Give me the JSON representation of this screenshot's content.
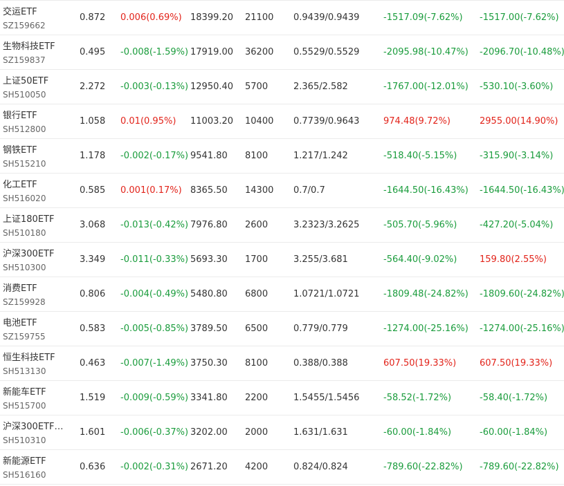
{
  "colors": {
    "up": "#e2231a",
    "down": "#1a9c3c",
    "text": "#333333",
    "subtext": "#666666",
    "divider": "#ebebeb"
  },
  "rows": [
    {
      "name": "交运ETF",
      "code": "SZ159662",
      "price": "0.872",
      "change": "0.006(0.69%)",
      "change_dir": "up",
      "market_value": "18399.20",
      "quantity": "21100",
      "cost": "0.9439/0.9439",
      "pl1": "-1517.09(-7.62%)",
      "pl1_dir": "down",
      "pl2": "-1517.00(-7.62%)",
      "pl2_dir": "down"
    },
    {
      "name": "生物科技ETF",
      "code": "SZ159837",
      "price": "0.495",
      "change": "-0.008(-1.59%)",
      "change_dir": "down",
      "market_value": "17919.00",
      "quantity": "36200",
      "cost": "0.5529/0.5529",
      "pl1": "-2095.98(-10.47%)",
      "pl1_dir": "down",
      "pl2": "-2096.70(-10.48%)",
      "pl2_dir": "down"
    },
    {
      "name": "上证50ETF",
      "code": "SH510050",
      "price": "2.272",
      "change": "-0.003(-0.13%)",
      "change_dir": "down",
      "market_value": "12950.40",
      "quantity": "5700",
      "cost": "2.365/2.582",
      "pl1": "-1767.00(-12.01%)",
      "pl1_dir": "down",
      "pl2": "-530.10(-3.60%)",
      "pl2_dir": "down"
    },
    {
      "name": "银行ETF",
      "code": "SH512800",
      "price": "1.058",
      "change": "0.01(0.95%)",
      "change_dir": "up",
      "market_value": "11003.20",
      "quantity": "10400",
      "cost": "0.7739/0.9643",
      "pl1": "974.48(9.72%)",
      "pl1_dir": "up",
      "pl2": "2955.00(14.90%)",
      "pl2_dir": "up"
    },
    {
      "name": "钢铁ETF",
      "code": "SH515210",
      "price": "1.178",
      "change": "-0.002(-0.17%)",
      "change_dir": "down",
      "market_value": "9541.80",
      "quantity": "8100",
      "cost": "1.217/1.242",
      "pl1": "-518.40(-5.15%)",
      "pl1_dir": "down",
      "pl2": "-315.90(-3.14%)",
      "pl2_dir": "down"
    },
    {
      "name": "化工ETF",
      "code": "SH516020",
      "price": "0.585",
      "change": "0.001(0.17%)",
      "change_dir": "up",
      "market_value": "8365.50",
      "quantity": "14300",
      "cost": "0.7/0.7",
      "pl1": "-1644.50(-16.43%)",
      "pl1_dir": "down",
      "pl2": "-1644.50(-16.43%)",
      "pl2_dir": "down"
    },
    {
      "name": "上证180ETF",
      "code": "SH510180",
      "price": "3.068",
      "change": "-0.013(-0.42%)",
      "change_dir": "down",
      "market_value": "7976.80",
      "quantity": "2600",
      "cost": "3.2323/3.2625",
      "pl1": "-505.70(-5.96%)",
      "pl1_dir": "down",
      "pl2": "-427.20(-5.04%)",
      "pl2_dir": "down"
    },
    {
      "name": "沪深300ETF",
      "code": "SH510300",
      "price": "3.349",
      "change": "-0.011(-0.33%)",
      "change_dir": "down",
      "market_value": "5693.30",
      "quantity": "1700",
      "cost": "3.255/3.681",
      "pl1": "-564.40(-9.02%)",
      "pl1_dir": "down",
      "pl2": "159.80(2.55%)",
      "pl2_dir": "up"
    },
    {
      "name": "消费ETF",
      "code": "SZ159928",
      "price": "0.806",
      "change": "-0.004(-0.49%)",
      "change_dir": "down",
      "market_value": "5480.80",
      "quantity": "6800",
      "cost": "1.0721/1.0721",
      "pl1": "-1809.48(-24.82%)",
      "pl1_dir": "down",
      "pl2": "-1809.60(-24.82%)",
      "pl2_dir": "down"
    },
    {
      "name": "电池ETF",
      "code": "SZ159755",
      "price": "0.583",
      "change": "-0.005(-0.85%)",
      "change_dir": "down",
      "market_value": "3789.50",
      "quantity": "6500",
      "cost": "0.779/0.779",
      "pl1": "-1274.00(-25.16%)",
      "pl1_dir": "down",
      "pl2": "-1274.00(-25.16%)",
      "pl2_dir": "down"
    },
    {
      "name": "恒生科技ETF",
      "code": "SH513130",
      "price": "0.463",
      "change": "-0.007(-1.49%)",
      "change_dir": "down",
      "market_value": "3750.30",
      "quantity": "8100",
      "cost": "0.388/0.388",
      "pl1": "607.50(19.33%)",
      "pl1_dir": "up",
      "pl2": "607.50(19.33%)",
      "pl2_dir": "up"
    },
    {
      "name": "新能车ETF",
      "code": "SH515700",
      "price": "1.519",
      "change": "-0.009(-0.59%)",
      "change_dir": "down",
      "market_value": "3341.80",
      "quantity": "2200",
      "cost": "1.5455/1.5456",
      "pl1": "-58.52(-1.72%)",
      "pl1_dir": "down",
      "pl2": "-58.40(-1.72%)",
      "pl2_dir": "down"
    },
    {
      "name": "沪深300ETF…",
      "code": "SH510310",
      "price": "1.601",
      "change": "-0.006(-0.37%)",
      "change_dir": "down",
      "market_value": "3202.00",
      "quantity": "2000",
      "cost": "1.631/1.631",
      "pl1": "-60.00(-1.84%)",
      "pl1_dir": "down",
      "pl2": "-60.00(-1.84%)",
      "pl2_dir": "down"
    },
    {
      "name": "新能源ETF",
      "code": "SH516160",
      "price": "0.636",
      "change": "-0.002(-0.31%)",
      "change_dir": "down",
      "market_value": "2671.20",
      "quantity": "4200",
      "cost": "0.824/0.824",
      "pl1": "-789.60(-22.82%)",
      "pl1_dir": "down",
      "pl2": "-789.60(-22.82%)",
      "pl2_dir": "down"
    }
  ]
}
